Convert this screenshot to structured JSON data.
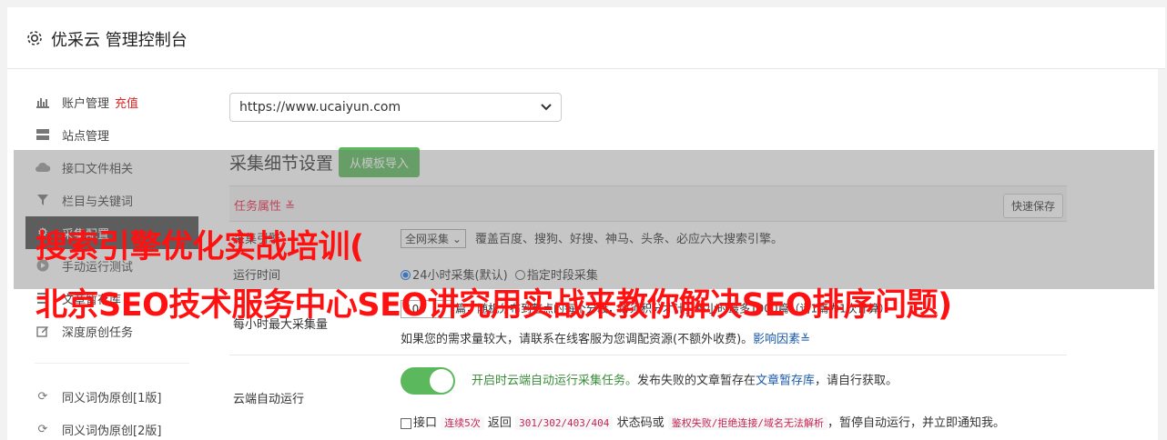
{
  "header": {
    "title": "优采云 管理控制台",
    "icon": "gear-icon"
  },
  "sidebar": {
    "items": [
      {
        "label": "账户管理",
        "extra": "充值",
        "icon": "bar-chart-icon"
      },
      {
        "label": "站点管理",
        "icon": "server-icon"
      },
      {
        "label": "接口文件相关",
        "icon": "cloud-upload-icon"
      },
      {
        "label": "栏目与关键词",
        "icon": "filter-icon"
      },
      {
        "label": "采集配置",
        "icon": "settings-icon"
      },
      {
        "label": "手动运行测试",
        "icon": "play-icon"
      },
      {
        "label": "文章暂存库",
        "icon": "list-icon"
      },
      {
        "label": "深度原创任务",
        "icon": "edit-icon"
      },
      {
        "label": "同义词伪原创[1版]",
        "icon": "refresh-icon"
      },
      {
        "label": "同义词伪原创[2版]",
        "icon": "refresh-icon"
      }
    ]
  },
  "main": {
    "site_select": "https://www.ucaiyun.com",
    "section_title": "采集细节设置",
    "import_button": "从模板导入",
    "task_attr": "任务属性 ≚",
    "quick_save": "快速保存",
    "rows": {
      "engine": {
        "label": "采集引擎",
        "select": "全网采集",
        "desc": "覆盖百度、搜狗、好搜、神马、头条、必应六大搜索引擎。"
      },
      "runtime": {
        "label": "运行时间",
        "opt1": "24小时采集(默认)",
        "opt2": "指定时段采集"
      },
      "max": {
        "label": "每小时最大采集量",
        "value": "100",
        "desc": "篇，随机分布到整点的每个分段，必须积分才计，每小时最多1000篇（请1篇为1次计算）",
        "note": "如果您的需求量较大，请联系在线客服为您调配资源(不额外收费)。",
        "link": "影响因素≚"
      },
      "cloud": {
        "label": "云端自动运行",
        "on_text": "开启时云端自动运行采集任务。",
        "desc1": "发布失败的文章暂存在",
        "link": "文章暂存库",
        "desc2": "，请自行获取。",
        "cb_prefix": "接口",
        "code1": "连续5次",
        "mid1": "返回",
        "code2": "301/302/403/404",
        "mid2": "状态码或",
        "code3": "鉴权失败/拒绝连接/域名无法解析",
        "tail": "，暂停自动运行，并立即通知我。"
      }
    },
    "colors": {
      "toggle_on": "#5cb85c",
      "accent_red": "#e02424"
    }
  },
  "overlay": {
    "line1": "搜索引擎优化实战培训(",
    "line2": "北京SEO技术服务中心SEO讲究用实战来教你解决SEO排序问题)"
  }
}
